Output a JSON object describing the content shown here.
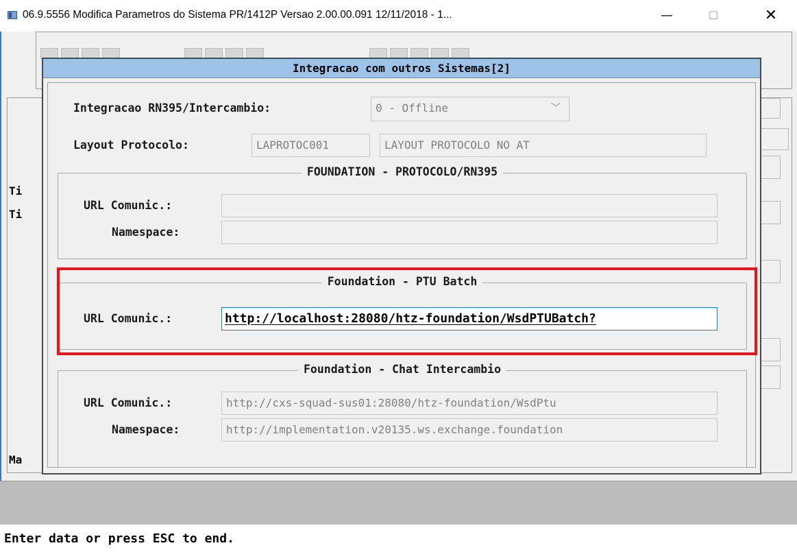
{
  "window": {
    "title": "06.9.5556  Modifica  Parametros do Sistema PR/1412P Versao 2.00.00.091 12/11/2018 - 1...",
    "minimize_glyph": "—",
    "maximize_glyph": "☐",
    "close_glyph": "✕"
  },
  "background": {
    "labels": [
      "Ti",
      "Ti",
      "Ma"
    ]
  },
  "dialog": {
    "title": "Integracao com outros Sistemas[2]",
    "integracao": {
      "label": "Integracao RN395/Intercambio:",
      "value": "0 - Offline",
      "chevron": "﹀"
    },
    "layout_protocolo": {
      "label": "Layout Protocolo:",
      "code": "LAPROTOC001",
      "description": "LAYOUT PROTOCOLO NO AT"
    },
    "group_protocolo": {
      "title": "FOUNDATION - PROTOCOLO/RN395",
      "url_label": "URL Comunic.:",
      "url_value": "",
      "namespace_label": "Namespace:",
      "namespace_value": ""
    },
    "group_ptu": {
      "title": "Foundation - PTU Batch",
      "url_label": "URL Comunic.:",
      "url_value": "http://localhost:28080/htz-foundation/WsdPTUBatch?"
    },
    "group_chat": {
      "title": "Foundation - Chat Intercambio",
      "url_label": "URL Comunic.:",
      "url_value": "http://cxs-squad-sus01:28080/htz-foundation/WsdPtu",
      "namespace_label": "Namespace:",
      "namespace_value": "http://implementation.v20135.ws.exchange.foundation"
    }
  },
  "status": {
    "message": "Enter data or press ESC to end."
  },
  "colors": {
    "dialog_title_bg": "#9ec3e9",
    "highlight": "#e8141c",
    "active_border": "#1e7ad8"
  }
}
